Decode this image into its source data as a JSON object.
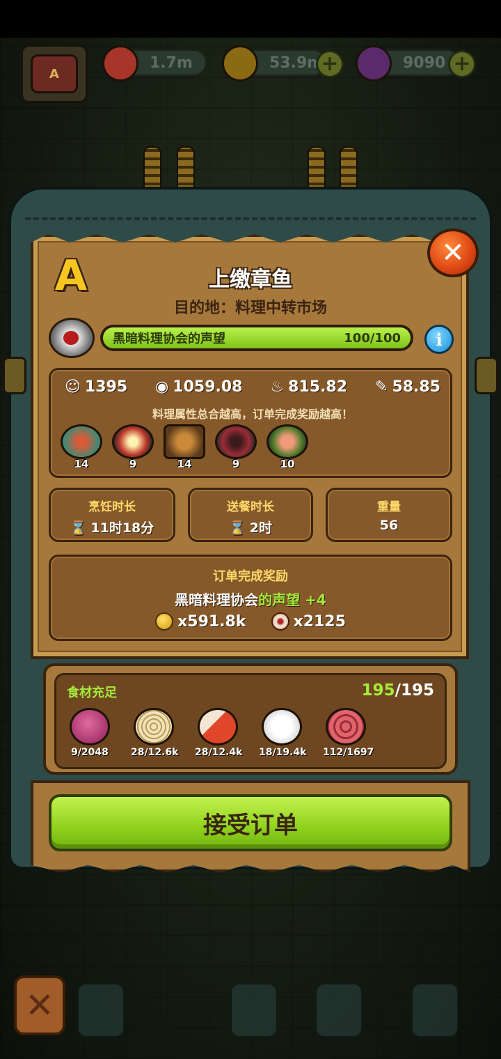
{
  "resources": [
    {
      "icon": "eyeball-icon",
      "value": "1.7m",
      "color": "#c0392b"
    },
    {
      "icon": "coin-icon",
      "value": "53.9m",
      "color": "#d4a017"
    },
    {
      "icon": "potion-icon",
      "value": "9090",
      "color": "#8e44ad"
    }
  ],
  "order": {
    "grade": "A",
    "title": "上缴章鱼",
    "destination": "目的地：料理中转市场",
    "reputation": {
      "label": "黑暗料理协会的声望",
      "value": "100/100",
      "progress": 1.0
    }
  },
  "stats": {
    "items": [
      {
        "icon": "mask-icon",
        "symbol": "☺",
        "value": "1395"
      },
      {
        "icon": "eye-icon",
        "symbol": "◉",
        "value": "1059.08"
      },
      {
        "icon": "flame-icon",
        "symbol": "♨",
        "value": "815.82"
      },
      {
        "icon": "knife-icon",
        "symbol": "✎",
        "value": "58.85"
      }
    ],
    "hint": "料理属性总合越高，订单完成奖励越高！",
    "dishes": [
      {
        "name": "noodle-dish-icon",
        "count": "14",
        "color": "#3f8a74"
      },
      {
        "name": "egg-rice-dish-icon",
        "count": "9",
        "color": "#c0392b"
      },
      {
        "name": "fried-dish-icon",
        "count": "14",
        "color": "#8a5a22"
      },
      {
        "name": "octopus-dish-icon",
        "count": "9",
        "color": "#9b2c36"
      },
      {
        "name": "shrimp-dish-icon",
        "count": "10",
        "color": "#4c7a2a"
      }
    ]
  },
  "times": [
    {
      "label": "烹饪时长",
      "value": "11时18分",
      "hourglass": true
    },
    {
      "label": "送餐时长",
      "value": "2时",
      "hourglass": true
    },
    {
      "label": "重量",
      "value": "56",
      "hourglass": false
    }
  ],
  "reward": {
    "label": "订单完成奖励",
    "rep_org": "黑暗料理协会",
    "rep_suffix": "的声望",
    "rep_amount": "+4",
    "coins": "x591.8k",
    "eyes": "x2125"
  },
  "ingredients": {
    "title": "食材充足",
    "have": "195",
    "sep_total": "/195",
    "items": [
      {
        "name": "onion-icon",
        "count": "9/2048",
        "color": "#b8346e"
      },
      {
        "name": "noodles-icon",
        "count": "28/12.6k",
        "color": "#e2cf9a"
      },
      {
        "name": "meat-icon",
        "count": "28/12.4k",
        "color": "#e0462a"
      },
      {
        "name": "rice-icon",
        "count": "18/19.4k",
        "color": "#f1f1f1"
      },
      {
        "name": "tentacle-icon",
        "count": "112/1697",
        "color": "#cc4a55"
      }
    ]
  },
  "accept_label": "接受订单",
  "close_symbol": "✕",
  "hourglass_symbol": "⌛",
  "plus_symbol": "+"
}
